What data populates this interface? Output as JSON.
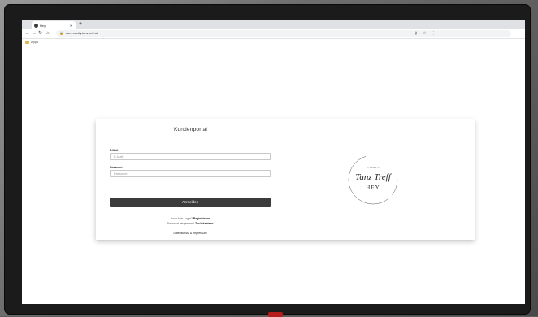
{
  "browser": {
    "tab_title": "Hey",
    "new_tab_icon": "plus-icon",
    "url": "community.tanztreff.at",
    "bookmark_label": "Apps"
  },
  "login": {
    "title": "Kundenportal",
    "email_label": "E-Mail",
    "email_placeholder": "E-Mail",
    "password_label": "Passwort",
    "password_placeholder": "Passwort",
    "submit_label": "Anmelden",
    "register_prefix": "Noch kein Login?",
    "register_link": "Registrieren",
    "forgot_prefix": "Passwort vergessen?",
    "forgot_link": "Zurücksetzen",
    "privacy_link": "Datenschutz & Impressum"
  },
  "logo": {
    "script_text": "Tanz Treff",
    "sub_text": "HEY",
    "small_text": "— CLUB —"
  },
  "colors": {
    "button_bg": "#3b3b3b",
    "title_color": "#333333"
  }
}
